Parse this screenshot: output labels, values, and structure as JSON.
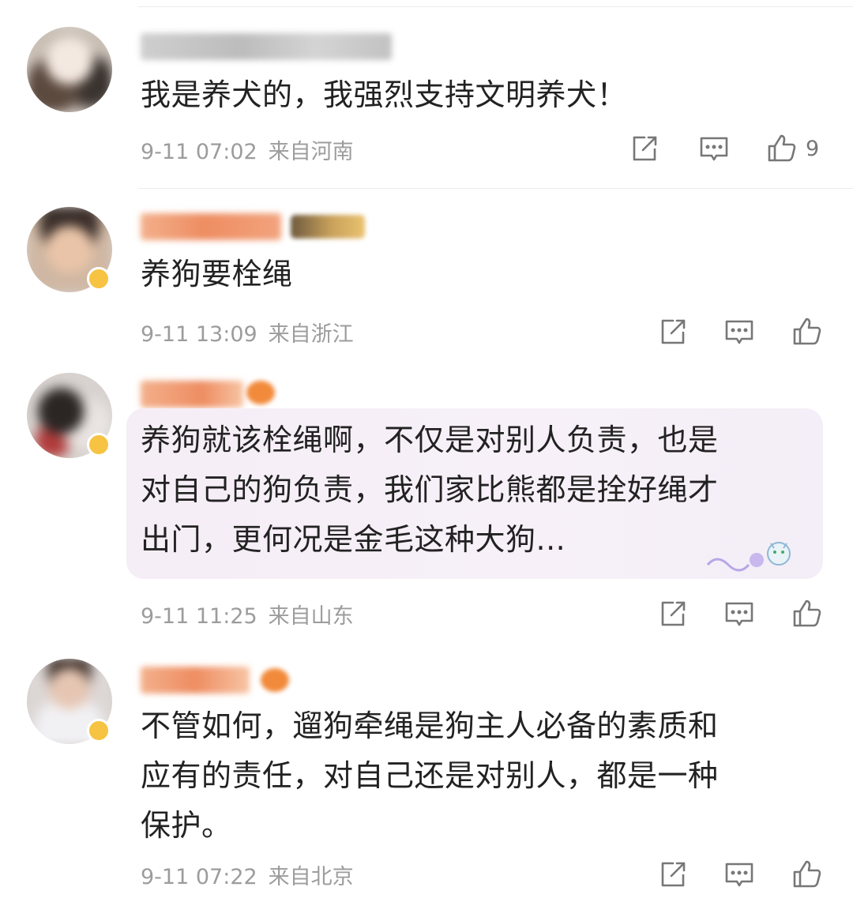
{
  "comments": [
    {
      "text": "我是养犬的，我强烈支持文明养犬！",
      "time": "9-11 07:02",
      "location": "来自河南",
      "likes": "9",
      "icons": {
        "share": "share-icon",
        "comment": "comment-icon",
        "like": "like-icon"
      }
    },
    {
      "text": "养狗要栓绳",
      "time": "9-11 13:09",
      "location": "来自浙江",
      "likes": "",
      "icons": {
        "share": "share-icon",
        "comment": "comment-icon",
        "like": "like-icon"
      }
    },
    {
      "text_lines": [
        "养狗就该栓绳啊，不仅是对别人负责，也是",
        "对自己的狗负责，我们家比熊都是拴好绳才",
        "出门，更何况是金毛这种大狗..."
      ],
      "time": "9-11 11:25",
      "location": "来自山东",
      "likes": "",
      "icons": {
        "share": "share-icon",
        "comment": "comment-icon",
        "like": "like-icon"
      }
    },
    {
      "text_lines": [
        "不管如何，遛狗牵绳是狗主人必备的素质和",
        "应有的责任，对自己还是对别人，都是一种",
        "保护。"
      ],
      "time": "9-11 07:22",
      "location": "来自北京",
      "likes": "",
      "icons": {
        "share": "share-icon",
        "comment": "comment-icon",
        "like": "like-icon"
      }
    }
  ],
  "colors": {
    "text": "#222222",
    "meta": "#9c9c9c",
    "icon": "#777777",
    "bubble": "#f5eef6",
    "vip_badge": "#f6c342"
  }
}
